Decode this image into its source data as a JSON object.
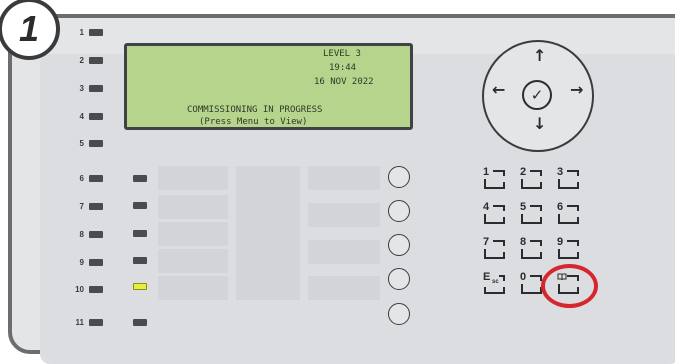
{
  "step_number": "1",
  "zones": [
    "1",
    "2",
    "3",
    "4",
    "5",
    "6",
    "7",
    "8",
    "9",
    "10",
    "11"
  ],
  "lcd": {
    "level": "LEVEL 3",
    "time": "19:44",
    "date": "16 NOV 2022",
    "status": "COMMISSIONING IN PROGRESS",
    "hint": "(Press Menu to View)"
  },
  "keypad": {
    "keys": [
      "1",
      "2",
      "3",
      "4",
      "5",
      "6",
      "7",
      "8",
      "9",
      "E",
      "0",
      ""
    ],
    "esc_sub": "sc"
  },
  "nav": {
    "up": "↑",
    "down": "↓",
    "left": "←",
    "right": "→",
    "center": "✓"
  },
  "colors": {
    "lcd_bg": "#b7d48c",
    "highlight": "#d7262e",
    "led_active": "#e8ec3a"
  },
  "icons": {
    "menu_key": "book-icon"
  }
}
